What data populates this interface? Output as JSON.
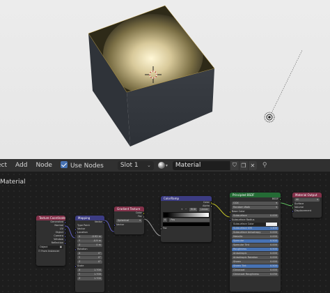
{
  "header": {
    "partial_item": "ect",
    "add": "Add",
    "node": "Node",
    "use_nodes": "Use Nodes",
    "slot": "Slot 1",
    "material_name": "Material"
  },
  "editor": {
    "title": "Material"
  },
  "nodes": {
    "texcoord": {
      "title": "Texture Coordinate",
      "outputs": [
        "Generated",
        "Normal",
        "UV",
        "Object",
        "Camera",
        "Window",
        "Reflection"
      ],
      "object_label": "Object",
      "from_instancer": "From Instancer"
    },
    "mapping": {
      "title": "Mapping",
      "out": "Vector",
      "type_label": "Type",
      "type_value": "Point",
      "vector": "Vector",
      "location": "Location",
      "loc": [
        "X",
        "-0.92 m",
        "Y",
        "-0.9 m",
        "Z",
        "0 m"
      ],
      "rotation": "Rotation",
      "rot": [
        "X",
        "0°",
        "Y",
        "0°",
        "Z",
        "0°"
      ],
      "scale": "Scale",
      "scl": [
        "X",
        "1.700",
        "Y",
        "1.700",
        "Z",
        "1.700"
      ]
    },
    "gradient": {
      "title": "Gradient Texture",
      "outputs": [
        "Color",
        "Fac"
      ],
      "type": "Spherical",
      "vector": "Vector"
    },
    "colorramp": {
      "title": "ColorRamp",
      "outputs": [
        "Color",
        "Alpha"
      ],
      "mode1": "RGB",
      "mode2": "Linear",
      "pos": "Pos",
      "fac": "Fac"
    },
    "bsdf": {
      "title": "Principled BSDF",
      "out": "BSDF",
      "dist": "GGX",
      "sss": "Random Walk",
      "inputs": [
        "Base Color",
        "Subsurface",
        "Subsurface Radius",
        "Subsurface Color",
        "Subsurface IOR",
        "Subsurface Anisotropy",
        "Metallic",
        "Specular",
        "Specular Tint",
        "Roughness",
        "Anisotropic",
        "Anisotropic Rotation",
        "Sheen",
        "Sheen Tint",
        "Clearcoat",
        "Clearcoat Roughness"
      ],
      "values": [
        "",
        "0.000",
        "",
        "",
        "1.400",
        "0.000",
        "0.000",
        "0.500",
        "0.000",
        "0.500",
        "0.000",
        "0.000",
        "0.000",
        "0.500",
        "0.000",
        "0.030"
      ]
    },
    "output": {
      "title": "Material Output",
      "target": "All",
      "inputs": [
        "Surface",
        "Volume",
        "Displacement"
      ]
    }
  },
  "colors": {
    "accent": "#4772b3",
    "texcoord_header": "#83314a",
    "mapping_header": "#3c3c83",
    "gradient_header": "#83314a",
    "colorramp_header": "#3c3c83",
    "bsdf_header": "#246b35",
    "output_header": "#83314a"
  }
}
